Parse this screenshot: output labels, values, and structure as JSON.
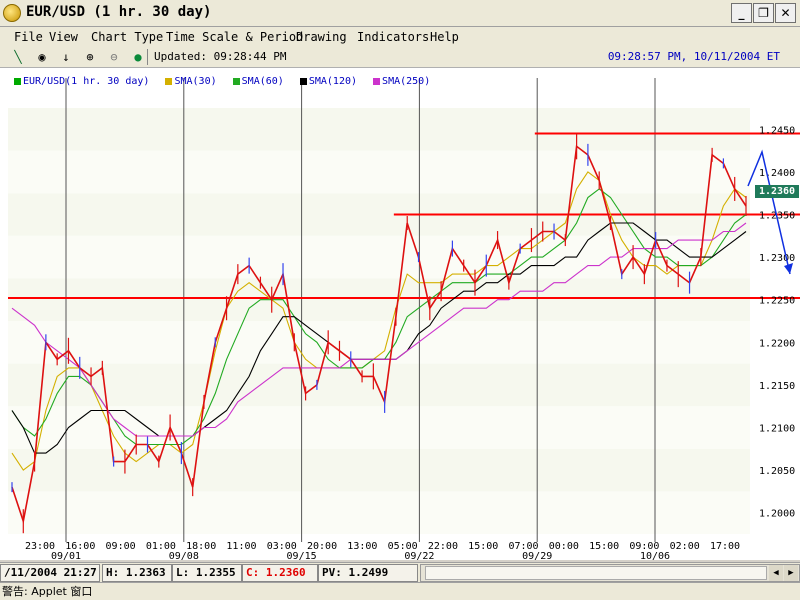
{
  "window": {
    "title": "EUR/USD  (1 hr.  30 day)",
    "minimize_label": "_",
    "restore_label": "❐",
    "close_label": "✕"
  },
  "menu": {
    "items": [
      "File",
      "View",
      "Chart Type",
      "Time Scale & Period",
      "Drawing",
      "Indicators",
      "Help"
    ]
  },
  "toolbar": {
    "updated": "Updated: 09:28:44 PM",
    "clock": "09:28:57 PM, 10/11/2004 ET"
  },
  "legend": [
    {
      "label": "EUR/USD(1 hr.  30 day)",
      "color": "#00aa00"
    },
    {
      "label": "SMA(30)",
      "color": "#d4b000"
    },
    {
      "label": "SMA(60)",
      "color": "#22aa22"
    },
    {
      "label": "SMA(120)",
      "color": "#000000"
    },
    {
      "label": "SMA(250)",
      "color": "#cc33cc"
    }
  ],
  "current_price_label": "1.2360",
  "status": {
    "date": "/11/2004 21:27",
    "high_label": "H:",
    "high": "1.2363",
    "low_label": "L:",
    "low": "1.2355",
    "close_label": "C:",
    "close": "1.2360",
    "pv_label": "PV:",
    "pv": "1.2499"
  },
  "footer": "警告: Applet 窗口",
  "chart_data": {
    "type": "line",
    "instrument": "EUR/USD",
    "interval": "1 hr.",
    "period": "30 day",
    "ylim": [
      1.1975,
      1.2475
    ],
    "y_ticks": [
      1.2,
      1.205,
      1.21,
      1.215,
      1.22,
      1.225,
      1.23,
      1.235,
      1.24,
      1.245
    ],
    "y_tick_labels": [
      "1.2000",
      "1.2050",
      "1.2100",
      "1.2150",
      "1.2200",
      "1.2250",
      "1.2300",
      "1.2350",
      "1.2400",
      "1.2450"
    ],
    "x_time_labels": [
      "23:00",
      "16:00",
      "09:00",
      "01:00",
      "18:00",
      "11:00",
      "03:00",
      "20:00",
      "13:00",
      "05:00",
      "22:00",
      "15:00",
      "07:00",
      "00:00",
      "15:00",
      "09:00",
      "02:00",
      "17:00"
    ],
    "x_date_labels": [
      "09/01",
      "09/08",
      "09/15",
      "09/22",
      "09/29",
      "10/06"
    ],
    "grid": true,
    "legend_position": "top-left",
    "series": [
      {
        "name": "EUR/USD(1 hr.  30 day)",
        "color": "#dd1111",
        "values": [
          1.203,
          1.199,
          1.206,
          1.22,
          1.218,
          1.219,
          1.217,
          1.216,
          1.217,
          1.206,
          1.206,
          1.208,
          1.208,
          1.206,
          1.21,
          1.207,
          1.203,
          1.213,
          1.22,
          1.224,
          1.228,
          1.229,
          1.227,
          1.225,
          1.228,
          1.22,
          1.214,
          1.215,
          1.22,
          1.219,
          1.218,
          1.216,
          1.216,
          1.213,
          1.223,
          1.234,
          1.23,
          1.224,
          1.226,
          1.231,
          1.229,
          1.227,
          1.229,
          1.232,
          1.227,
          1.231,
          1.232,
          1.233,
          1.233,
          1.232,
          1.243,
          1.242,
          1.239,
          1.234,
          1.228,
          1.23,
          1.228,
          1.232,
          1.229,
          1.228,
          1.227,
          1.23,
          1.242,
          1.241,
          1.238,
          1.236
        ]
      },
      {
        "name": "SMA(30)",
        "color": "#d4b000",
        "values": [
          1.207,
          1.205,
          1.206,
          1.212,
          1.216,
          1.217,
          1.217,
          1.215,
          1.212,
          1.209,
          1.207,
          1.206,
          1.207,
          1.208,
          1.208,
          1.207,
          1.208,
          1.213,
          1.219,
          1.224,
          1.226,
          1.227,
          1.226,
          1.225,
          1.224,
          1.22,
          1.218,
          1.217,
          1.217,
          1.217,
          1.217,
          1.217,
          1.218,
          1.219,
          1.224,
          1.228,
          1.227,
          1.227,
          1.227,
          1.228,
          1.228,
          1.228,
          1.229,
          1.229,
          1.23,
          1.231,
          1.231,
          1.232,
          1.233,
          1.234,
          1.238,
          1.24,
          1.239,
          1.235,
          1.232,
          1.23,
          1.229,
          1.229,
          1.228,
          1.229,
          1.229,
          1.229,
          1.232,
          1.236,
          1.238,
          1.237
        ]
      },
      {
        "name": "SMA(60)",
        "color": "#22aa22",
        "values": [
          1.212,
          1.21,
          1.209,
          1.211,
          1.214,
          1.216,
          1.216,
          1.215,
          1.213,
          1.211,
          1.209,
          1.208,
          1.208,
          1.208,
          1.208,
          1.208,
          1.209,
          1.211,
          1.214,
          1.218,
          1.221,
          1.224,
          1.225,
          1.225,
          1.225,
          1.223,
          1.221,
          1.22,
          1.218,
          1.217,
          1.217,
          1.217,
          1.218,
          1.218,
          1.22,
          1.223,
          1.224,
          1.225,
          1.226,
          1.227,
          1.227,
          1.227,
          1.228,
          1.228,
          1.228,
          1.229,
          1.23,
          1.23,
          1.231,
          1.232,
          1.234,
          1.237,
          1.238,
          1.237,
          1.235,
          1.233,
          1.231,
          1.23,
          1.23,
          1.229,
          1.229,
          1.229,
          1.23,
          1.232,
          1.234,
          1.235
        ]
      },
      {
        "name": "SMA(120)",
        "color": "#000000",
        "values": [
          1.212,
          1.21,
          1.207,
          1.207,
          1.208,
          1.21,
          1.211,
          1.212,
          1.212,
          1.212,
          1.212,
          1.211,
          1.21,
          1.209,
          1.209,
          1.209,
          1.209,
          1.21,
          1.211,
          1.212,
          1.214,
          1.216,
          1.219,
          1.221,
          1.223,
          1.223,
          1.222,
          1.221,
          1.22,
          1.219,
          1.218,
          1.218,
          1.218,
          1.218,
          1.218,
          1.219,
          1.221,
          1.222,
          1.224,
          1.225,
          1.226,
          1.226,
          1.227,
          1.227,
          1.228,
          1.228,
          1.229,
          1.229,
          1.229,
          1.23,
          1.23,
          1.232,
          1.233,
          1.234,
          1.234,
          1.234,
          1.233,
          1.232,
          1.232,
          1.231,
          1.23,
          1.23,
          1.23,
          1.231,
          1.232,
          1.233
        ]
      },
      {
        "name": "SMA(250)",
        "color": "#cc33cc",
        "values": [
          1.224,
          1.223,
          1.222,
          1.22,
          1.219,
          1.218,
          1.217,
          1.215,
          1.213,
          1.211,
          1.21,
          1.209,
          1.209,
          1.209,
          1.209,
          1.209,
          1.209,
          1.21,
          1.21,
          1.211,
          1.213,
          1.214,
          1.215,
          1.216,
          1.217,
          1.217,
          1.217,
          1.217,
          1.217,
          1.217,
          1.218,
          1.218,
          1.218,
          1.218,
          1.218,
          1.219,
          1.22,
          1.221,
          1.222,
          1.223,
          1.224,
          1.224,
          1.224,
          1.225,
          1.225,
          1.226,
          1.226,
          1.226,
          1.227,
          1.227,
          1.228,
          1.229,
          1.229,
          1.23,
          1.23,
          1.231,
          1.231,
          1.231,
          1.231,
          1.232,
          1.232,
          1.232,
          1.232,
          1.233,
          1.233,
          1.234
        ]
      }
    ],
    "horizontal_lines": [
      {
        "y": 1.2445,
        "color": "#ff0000",
        "x_start_fraction": 0.71
      },
      {
        "y": 1.235,
        "color": "#ff0000",
        "x_start_fraction": 0.52
      },
      {
        "y": 1.2252,
        "color": "#ff0000",
        "x_start_fraction": 0.0
      }
    ]
  }
}
